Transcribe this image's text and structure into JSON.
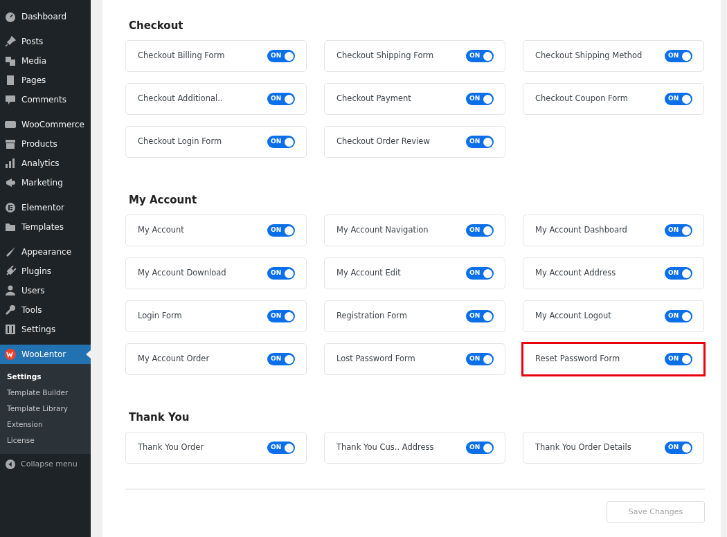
{
  "sidebar": {
    "groups": [
      [
        {
          "label": "Dashboard",
          "selected": false
        }
      ],
      [
        {
          "label": "Posts",
          "selected": false
        },
        {
          "label": "Media",
          "selected": false
        },
        {
          "label": "Pages",
          "selected": false
        },
        {
          "label": "Comments",
          "selected": false
        }
      ],
      [
        {
          "label": "WooCommerce",
          "selected": false
        },
        {
          "label": "Products",
          "selected": false
        },
        {
          "label": "Analytics",
          "selected": false
        },
        {
          "label": "Marketing",
          "selected": false
        }
      ],
      [
        {
          "label": "Elementor",
          "selected": false
        },
        {
          "label": "Templates",
          "selected": false
        }
      ],
      [
        {
          "label": "Appearance",
          "selected": false
        },
        {
          "label": "Plugins",
          "selected": false
        },
        {
          "label": "Users",
          "selected": false
        },
        {
          "label": "Tools",
          "selected": false
        },
        {
          "label": "Settings",
          "selected": false
        }
      ],
      [
        {
          "label": "WooLentor",
          "selected": true
        }
      ]
    ],
    "submenu": [
      {
        "label": "Settings",
        "selected": true
      },
      {
        "label": "Template Builder",
        "selected": false
      },
      {
        "label": "Template Library",
        "selected": false
      },
      {
        "label": "Extension",
        "selected": false
      },
      {
        "label": "License",
        "selected": false
      }
    ],
    "collapse": "Collapse menu"
  },
  "sections": [
    {
      "title": "Checkout",
      "items": [
        {
          "label": "Checkout Billing Form",
          "on": true,
          "toggle_text": "ON",
          "highlighted": false
        },
        {
          "label": "Checkout Shipping Form",
          "on": true,
          "toggle_text": "ON",
          "highlighted": false
        },
        {
          "label": "Checkout Shipping Method",
          "on": true,
          "toggle_text": "ON",
          "highlighted": false
        },
        {
          "label": "Checkout Additional..",
          "on": true,
          "toggle_text": "ON",
          "highlighted": false
        },
        {
          "label": "Checkout Payment",
          "on": true,
          "toggle_text": "ON",
          "highlighted": false
        },
        {
          "label": "Checkout Coupon Form",
          "on": true,
          "toggle_text": "ON",
          "highlighted": false
        },
        {
          "label": "Checkout Login Form",
          "on": true,
          "toggle_text": "ON",
          "highlighted": false
        },
        {
          "label": "Checkout Order Review",
          "on": true,
          "toggle_text": "ON",
          "highlighted": false
        }
      ]
    },
    {
      "title": "My Account",
      "items": [
        {
          "label": "My Account",
          "on": true,
          "toggle_text": "ON",
          "highlighted": false
        },
        {
          "label": "My Account Navigation",
          "on": true,
          "toggle_text": "ON",
          "highlighted": false
        },
        {
          "label": "My Account Dashboard",
          "on": true,
          "toggle_text": "ON",
          "highlighted": false
        },
        {
          "label": "My Account Download",
          "on": true,
          "toggle_text": "ON",
          "highlighted": false
        },
        {
          "label": "My Account Edit",
          "on": true,
          "toggle_text": "ON",
          "highlighted": false
        },
        {
          "label": "My Account Address",
          "on": true,
          "toggle_text": "ON",
          "highlighted": false
        },
        {
          "label": "Login Form",
          "on": true,
          "toggle_text": "ON",
          "highlighted": false
        },
        {
          "label": "Registration Form",
          "on": true,
          "toggle_text": "ON",
          "highlighted": false
        },
        {
          "label": "My Account Logout",
          "on": true,
          "toggle_text": "ON",
          "highlighted": false
        },
        {
          "label": "My Account Order",
          "on": true,
          "toggle_text": "ON",
          "highlighted": false
        },
        {
          "label": "Lost Password Form",
          "on": true,
          "toggle_text": "ON",
          "highlighted": false
        },
        {
          "label": "Reset Password Form",
          "on": true,
          "toggle_text": "ON",
          "highlighted": true
        }
      ]
    },
    {
      "title": "Thank You",
      "items": [
        {
          "label": "Thank You Order",
          "on": true,
          "toggle_text": "ON",
          "highlighted": false
        },
        {
          "label": "Thank You Cus.. Address",
          "on": true,
          "toggle_text": "ON",
          "highlighted": false
        },
        {
          "label": "Thank You Order Details",
          "on": true,
          "toggle_text": "ON",
          "highlighted": false
        }
      ]
    }
  ],
  "save_button": {
    "label": "Save Changes",
    "disabled": true
  }
}
